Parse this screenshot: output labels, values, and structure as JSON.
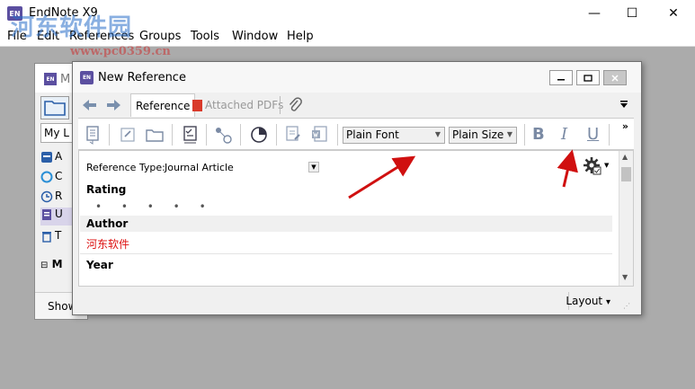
{
  "app": {
    "logo": "EN",
    "title": "EndNote X9",
    "watermark": "河东软件园",
    "watermark_url": "www.pc0359.cn",
    "minimize": "—",
    "maximize": "☐",
    "close": "✕"
  },
  "menu": [
    "File",
    "Edit",
    "References",
    "Groups",
    "Tools",
    "Window",
    "Help"
  ],
  "library": {
    "logo": "EN",
    "title_partial": "M",
    "tab_label": "My L",
    "rows": [
      {
        "letter": "A",
        "color": "#2b5fa8"
      },
      {
        "letter": "C",
        "color": "#2a8fd6"
      },
      {
        "letter": "R",
        "color": "#2b5fa8"
      },
      {
        "letter": "U",
        "color": "#5b4fa0"
      },
      {
        "letter": "T",
        "color": "#2b5fa8"
      }
    ],
    "group_label": "M",
    "show_label": "Show"
  },
  "reference": {
    "logo": "EN",
    "title": "New Reference",
    "tabs": {
      "reference": "Reference",
      "attached_pdfs": "Attached PDFs"
    },
    "font_select": "Plain Font",
    "size_select": "Plain Size",
    "bold": "B",
    "italic": "I",
    "underline": "U",
    "more": "»",
    "reference_type_label": "Reference Type:",
    "reference_type_value": "Journal Article",
    "rating_label": "Rating",
    "rating_dots": "• • • • •",
    "author_label": "Author",
    "author_value": "河东软件",
    "year_label": "Year",
    "layout_label": "Layout",
    "layout_arrow": "▾"
  }
}
